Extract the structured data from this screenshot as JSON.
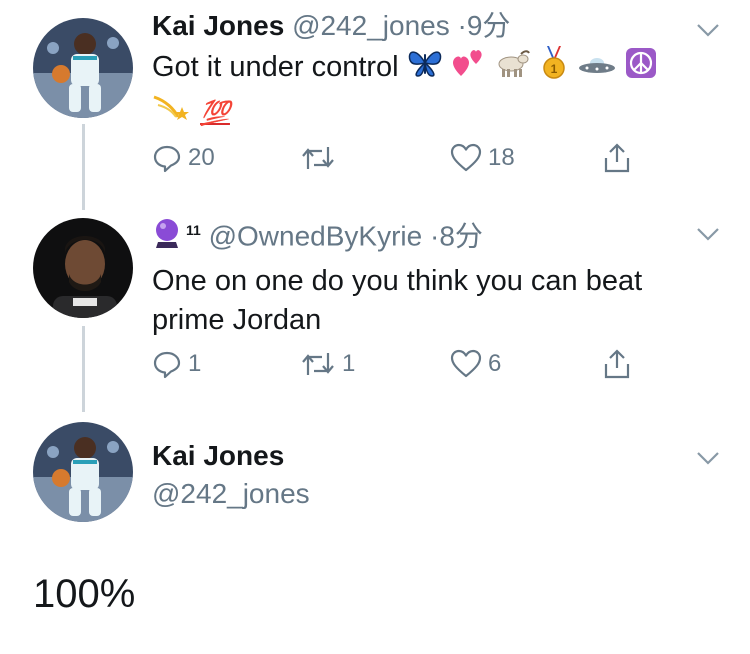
{
  "tweets": [
    {
      "name": "Kai Jones",
      "handle": "@242_jones",
      "dot": "·",
      "time": "9分",
      "text_line1": "Got it under control",
      "text_line2_suffix": "💯",
      "replies": "20",
      "retweets": "",
      "likes": "18"
    },
    {
      "name_badge": "11",
      "handle": "@OwnedByKyrie",
      "dot": "·",
      "time": "8分",
      "text": "One on one do you think you can beat prime Jordan",
      "replies": "1",
      "retweets": "1",
      "likes": "6"
    },
    {
      "name": "Kai Jones",
      "handle": "@242_jones"
    }
  ],
  "footer_text": "100%",
  "colors": {
    "text": "#14171a",
    "secondary": "#657786",
    "thread_line": "#cdd4da"
  }
}
